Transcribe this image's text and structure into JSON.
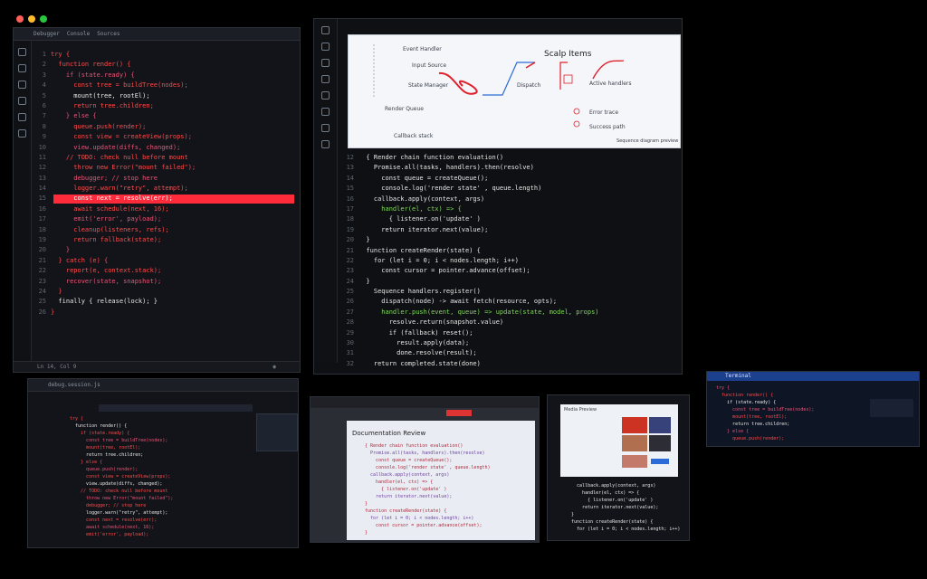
{
  "colors": {
    "accent_red": "#ff2a3a",
    "keyword_green": "#7fd85a",
    "diagram_arrow_red": "#e0202a",
    "blue_accent": "#2a6bd8"
  },
  "left_editor": {
    "tabs": [
      "Debugger",
      "Console",
      "Sources"
    ],
    "code_lines": [
      "try {",
      "  function render() {",
      "    if (state.ready) {",
      "      const tree = buildTree(nodes);",
      "      mount(tree, rootEl);",
      "      return tree.children;",
      "    } else {",
      "      queue.push(render);",
      "      const view = createView(props);",
      "      view.update(diffs, changed);",
      "    // TODO: check null before mount",
      "      throw new Error(\"mount failed\");",
      "      debugger; // stop here",
      "      logger.warn(\"retry\", attempt);",
      "      const next = resolve(err);",
      "      await schedule(next, 16);",
      "      emit('error', payload);",
      "      cleanup(listeners, refs);",
      "      return fallback(state);",
      "    }",
      "  } catch (e) {",
      "    report(e, context.stack);",
      "    recover(state, snapshot);",
      "  }",
      "  finally { release(lock); }",
      "}"
    ],
    "status": "Ln 14, Col 9"
  },
  "center_editor": {
    "diagram": {
      "title": "Scalp Items",
      "labels": [
        "Event Handler",
        "Input Source",
        "State Manager",
        "Dispatch",
        "Render Queue",
        "Callback stack"
      ],
      "side_labels": [
        "Active handlers",
        "Error trace",
        "Success path"
      ],
      "footer": "Sequence diagram preview"
    },
    "code_lines": [
      "  { Render chain function evaluation()",
      "    Promise.all(tasks, handlers).then(resolve)",
      "      const queue = createQueue();",
      "      console.log('render state' , queue.length)",
      "    callback.apply(context, args)",
      "      handler(el, ctx) => {",
      "        { listener.on('update' )",
      "      return iterator.next(value);",
      "  }",
      "  function createRender(state) {",
      "    for (let i = 0; i < nodes.length; i++)",
      "      const cursor = pointer.advance(offset);",
      "  }",
      "    Sequence handlers.register()",
      "      dispatch(node) -> await fetch(resource, opts);",
      "      handler.push(event, queue) => update(state, model, props)",
      "        resolve.return(snapshot.value)",
      "        if (fallback) reset();",
      "          result.apply(data);",
      "          done.resolve(result);",
      "    return completed.state(done)"
    ]
  },
  "bottom_panels": {
    "panel1_title": "debug.session.js",
    "panel2_title": "Documentation Review",
    "panel3_title": "Media Preview",
    "panel4_title": "Terminal"
  }
}
